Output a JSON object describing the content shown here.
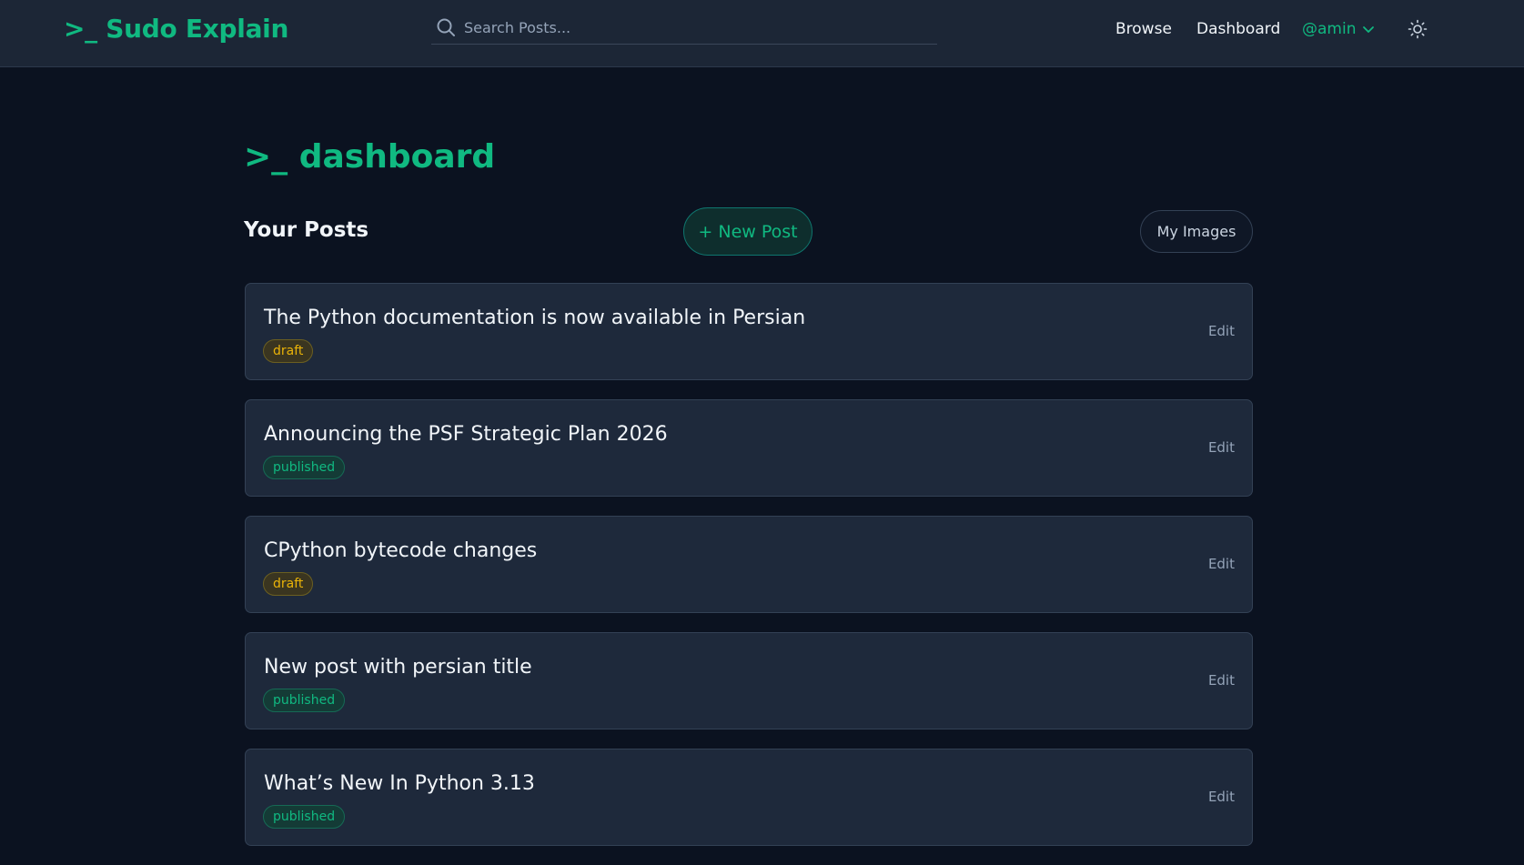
{
  "header": {
    "logo": ">_ Sudo Explain",
    "search": {
      "placeholder": "Search Posts...",
      "value": ""
    },
    "nav": {
      "browse": "Browse",
      "dashboard": "Dashboard",
      "user": "@amin"
    },
    "icons": {
      "search": "search-icon",
      "user_menu": "chevron-down-icon",
      "theme": "sun-icon"
    }
  },
  "main": {
    "title": ">_ dashboard",
    "section_title": "Your Posts",
    "new_post_label": "+ New Post",
    "images_label": "My Images",
    "posts": [
      {
        "title": "The Python documentation is now available in Persian",
        "status": "draft",
        "edit": "Edit"
      },
      {
        "title": "Announcing the PSF Strategic Plan 2026",
        "status": "published",
        "edit": "Edit"
      },
      {
        "title": "CPython bytecode changes",
        "status": "draft",
        "edit": "Edit"
      },
      {
        "title": "New post with persian title",
        "status": "published",
        "edit": "Edit"
      },
      {
        "title": "What’s New In Python 3.13",
        "status": "published",
        "edit": "Edit"
      }
    ]
  },
  "colors": {
    "accent": "#10b981",
    "background": "#0b1220",
    "header": "#1c2636",
    "card": "#1e293b",
    "draft": "#eab308",
    "published": "#10b981"
  }
}
